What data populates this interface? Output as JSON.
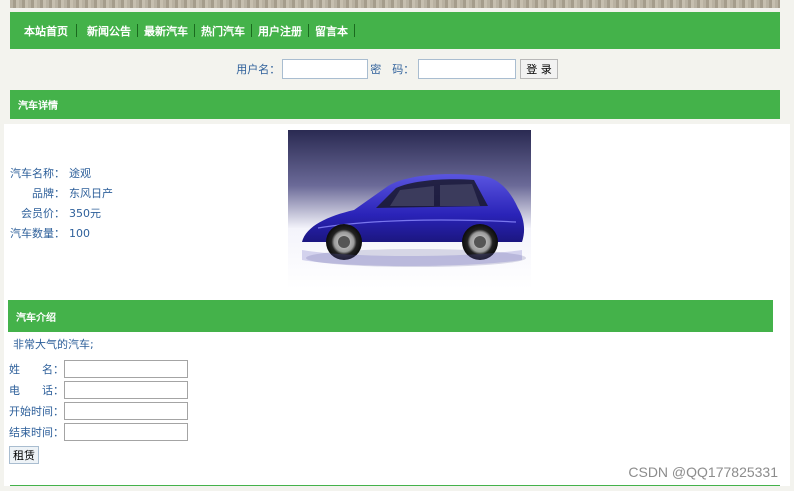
{
  "nav": {
    "items": [
      "本站首页",
      "新闻公告",
      "最新汽车",
      "热门汽车",
      "用户注册",
      "留言本"
    ]
  },
  "login": {
    "username_label": "用户名：",
    "password_label": "密　码：",
    "submit_label": "登 录"
  },
  "detail": {
    "title": "汽车详情",
    "fields": [
      {
        "label": "汽车名称：",
        "value": "途观"
      },
      {
        "label": "品牌：",
        "value": "东风日产"
      },
      {
        "label": "会员价：",
        "value": "350元"
      },
      {
        "label": "汽车数量：",
        "value": "100"
      }
    ]
  },
  "intro": {
    "title": "汽车介绍",
    "text": "非常大气的汽车;"
  },
  "rent_form": {
    "name_label": "姓　　名：",
    "phone_label": "电　　话：",
    "start_label": "开始时间：",
    "end_label": "结束时间：",
    "submit_label": "租赁"
  },
  "watermark": "CSDN @QQ177825331",
  "colors": {
    "accent": "#44b24a",
    "text": "#2d5f9a"
  }
}
